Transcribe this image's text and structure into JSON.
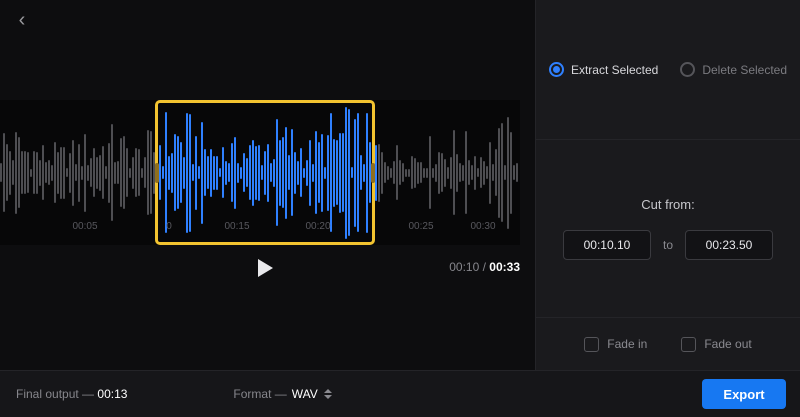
{
  "colors": {
    "accent_blue": "#2f80ff",
    "wave_gray": "#4e4e52",
    "selection_yellow": "#f2c330",
    "export_blue": "#1778f2"
  },
  "header": {
    "back_icon": "‹"
  },
  "player": {
    "time_labels": [
      "00:05",
      "0",
      "00:15",
      "00:20",
      "00:25",
      "00:30"
    ],
    "current_time": "00:10",
    "separator": "/",
    "total_time": "00:33"
  },
  "panel": {
    "extract_label": "Extract Selected",
    "delete_label": "Delete Selected",
    "cut_from_label": "Cut from:",
    "cut_start": "00:10.10",
    "to_label": "to",
    "cut_end": "00:23.50",
    "fade_in_label": "Fade in",
    "fade_out_label": "Fade out"
  },
  "footer": {
    "final_output_label": "Final output —",
    "final_output_value": "00:13",
    "format_label": "Format —",
    "format_value": "WAV",
    "export_label": "Export"
  }
}
